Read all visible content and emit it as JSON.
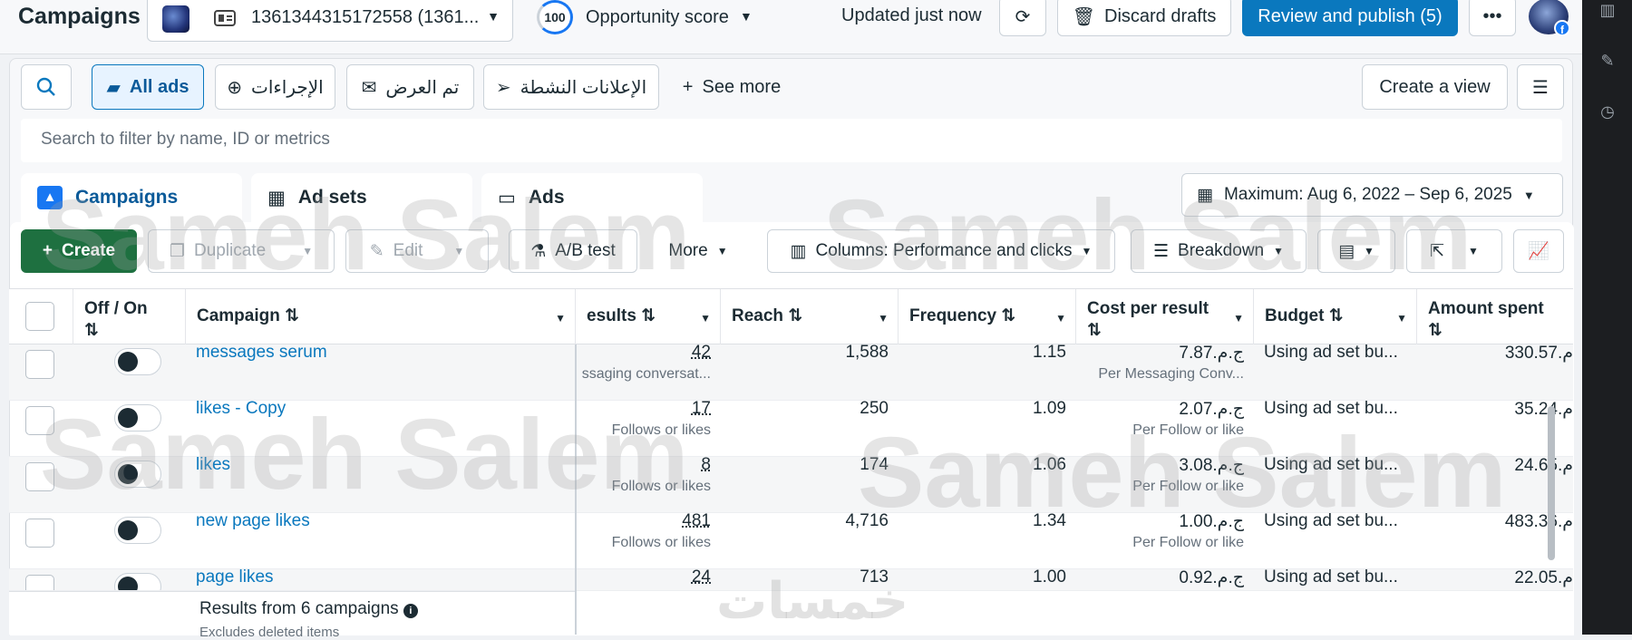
{
  "header": {
    "title": "Campaigns",
    "account_id": "1361344315172558 (1361...",
    "score_value": "100",
    "score_label": "Opportunity score",
    "updated": "Updated just now",
    "discard": "Discard drafts",
    "review": "Review and publish (5)"
  },
  "filters": {
    "all_ads": "All ads",
    "actions": "الإجراءات",
    "delivered": "تم العرض",
    "active_ads": "الإعلانات النشطة",
    "see_more": "See more",
    "create_view": "Create a view",
    "search_placeholder": "Search to filter by name, ID or metrics"
  },
  "tabs": {
    "campaigns": "Campaigns",
    "ad_sets": "Ad sets",
    "ads": "Ads"
  },
  "date_range": "Maximum: Aug 6, 2022 – Sep 6, 2025",
  "toolbar": {
    "create": "Create",
    "duplicate": "Duplicate",
    "edit": "Edit",
    "ab_test": "A/B test",
    "more": "More",
    "columns": "Columns: Performance and clicks",
    "breakdown": "Breakdown"
  },
  "table": {
    "columns": {
      "off_on": "Off / On",
      "campaign": "Campaign",
      "results": "esults",
      "reach": "Reach",
      "frequency": "Frequency",
      "cost_per_result": "Cost per result",
      "budget": "Budget",
      "amount_spent": "Amount spent"
    },
    "rows": [
      {
        "name": "messages serum",
        "results": "42",
        "results_sub": "ssaging conversat...",
        "reach": "1,588",
        "frequency": "1.15",
        "cpr": "ج.م.7.87",
        "cpr_sub": "Per Messaging Conv...",
        "budget": "Using ad set bu...",
        "spent": "330.57.م"
      },
      {
        "name": "likes - Copy",
        "results": "17",
        "results_sub": "Follows or likes",
        "reach": "250",
        "frequency": "1.09",
        "cpr": "ج.م.2.07",
        "cpr_sub": "Per Follow or like",
        "budget": "Using ad set bu...",
        "spent": "35.24.م"
      },
      {
        "name": "likes",
        "results": "8",
        "results_sub": "Follows or likes",
        "reach": "174",
        "frequency": "1.06",
        "cpr": "ج.م.3.08",
        "cpr_sub": "Per Follow or like",
        "budget": "Using ad set bu...",
        "spent": "24.65.م"
      },
      {
        "name": "new page likes",
        "results": "481",
        "results_sub": "Follows or likes",
        "reach": "4,716",
        "frequency": "1.34",
        "cpr": "ج.م.1.00",
        "cpr_sub": "Per Follow or like",
        "budget": "Using ad set bu...",
        "spent": "483.36.م"
      },
      {
        "name": "page likes",
        "results": "24",
        "results_sub": "",
        "reach": "713",
        "frequency": "1.00",
        "cpr": "ج.م.0.92",
        "cpr_sub": "",
        "budget": "Using ad set bu...",
        "spent": "22.05.م"
      }
    ],
    "footer": "Results from 6 campaigns",
    "footer_sub": "Excludes deleted items"
  },
  "watermark": "Sameh Salem",
  "watermark_logo": "خمسات"
}
